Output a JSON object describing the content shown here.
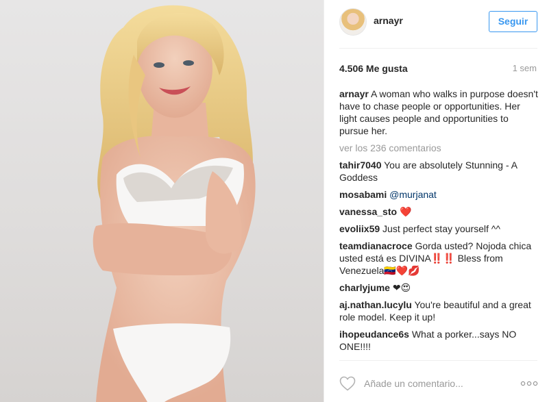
{
  "post": {
    "username": "arnayr",
    "follow_label": "Seguir",
    "likes_text": "4.506 Me gusta",
    "time_ago": "1 sem"
  },
  "caption": {
    "user": "arnayr",
    "text": "A woman who walks in purpose doesn't have to chase people or opportunities. Her light causes people and opportunities to pursue her."
  },
  "view_all_label": "ver los 236 comentarios",
  "comments": [
    {
      "user": "tahir7040",
      "text": "You are absolutely Stunning - A Goddess"
    },
    {
      "user": "mosabami",
      "mention": "@murjanat"
    },
    {
      "user": "vanessa_sto",
      "text": "❤️"
    },
    {
      "user": "evoliix59",
      "text": "Just perfect stay yourself ^^"
    },
    {
      "user": "teamdianacroce",
      "text": "Gorda usted? Nojoda chica usted está es DIVINA‼️‼️ Bless from Venezuela🇻🇪❤️💋"
    },
    {
      "user": "charlyjume",
      "text": "❤😍"
    },
    {
      "user": "aj.nathan.lucylu",
      "text": "You're beautiful and a great role model. Keep it up!"
    },
    {
      "user": "ihopeudance6s",
      "text": "What a porker...says NO ONE!!!!"
    }
  ],
  "add_comment_placeholder": "Añade un comentario...",
  "icons": {
    "like": "heart-outline-icon",
    "more": "more-options-icon"
  },
  "colors": {
    "link_blue": "#3897f0",
    "mention_blue": "#003569",
    "muted": "#999999"
  }
}
